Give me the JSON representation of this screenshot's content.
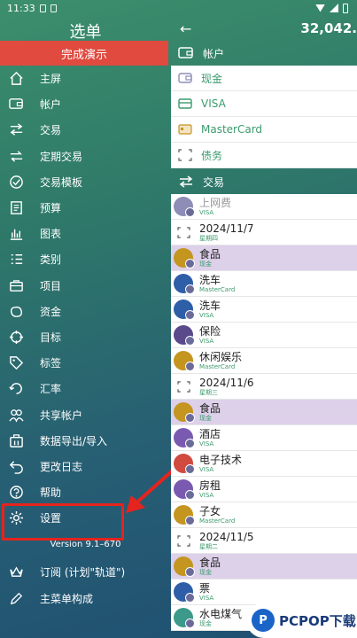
{
  "status": {
    "time": "11:33"
  },
  "drawer": {
    "title": "选单",
    "finish_demo": "完成演示",
    "items": [
      {
        "label": "主屏",
        "icon": "home-icon"
      },
      {
        "label": "帐户",
        "icon": "wallet-icon"
      },
      {
        "label": "交易",
        "icon": "swap-icon"
      },
      {
        "label": "定期交易",
        "icon": "recurring-icon"
      },
      {
        "label": "交易模板",
        "icon": "template-icon"
      },
      {
        "label": "预算",
        "icon": "budget-icon"
      },
      {
        "label": "图表",
        "icon": "chart-icon"
      },
      {
        "label": "类别",
        "icon": "category-icon"
      },
      {
        "label": "项目",
        "icon": "project-icon"
      },
      {
        "label": "资金",
        "icon": "funds-icon"
      },
      {
        "label": "目标",
        "icon": "target-icon"
      },
      {
        "label": "标签",
        "icon": "tag-icon"
      },
      {
        "label": "汇率",
        "icon": "exchange-icon"
      },
      {
        "label": "共享帐户",
        "icon": "shared-icon"
      },
      {
        "label": "数据导出/导入",
        "icon": "export-icon"
      },
      {
        "label": "更改日志",
        "icon": "changelog-icon"
      },
      {
        "label": "帮助",
        "icon": "help-icon"
      },
      {
        "label": "设置",
        "icon": "gear-icon"
      }
    ],
    "version": "Version 9.1–670",
    "items2": [
      {
        "label": "订阅 (计划\"轨道\")",
        "icon": "crown-icon"
      },
      {
        "label": "主菜单构成",
        "icon": "edit-icon"
      }
    ]
  },
  "right": {
    "total": "32,042.",
    "accounts_label": "帐户",
    "accounts": [
      {
        "name": "现金",
        "icon": "cash-icon"
      },
      {
        "name": "VISA",
        "icon": "card-icon"
      },
      {
        "name": "MasterCard",
        "icon": "card-icon"
      },
      {
        "name": "债务",
        "icon": "debt-icon"
      }
    ],
    "transactions_label": "交易",
    "transactions": [
      {
        "title": "上网费",
        "sub": "VISA",
        "kind": "faded",
        "color": "#8d8db8"
      },
      {
        "title": "2024/11/7",
        "sub": "星期四",
        "kind": "date"
      },
      {
        "title": "食品",
        "sub": "现金",
        "kind": "food",
        "color": "#c4951f"
      },
      {
        "title": "洗车",
        "sub": "MasterCard",
        "kind": "",
        "color": "#2f5ea8"
      },
      {
        "title": "洗车",
        "sub": "VISA",
        "kind": "",
        "color": "#2f5ea8"
      },
      {
        "title": "保险",
        "sub": "VISA",
        "kind": "",
        "color": "#5a4a8c"
      },
      {
        "title": "休闲娱乐",
        "sub": "MasterCard",
        "kind": "",
        "color": "#c4951f"
      },
      {
        "title": "2024/11/6",
        "sub": "星期三",
        "kind": "date"
      },
      {
        "title": "食品",
        "sub": "现金",
        "kind": "food",
        "color": "#c4951f"
      },
      {
        "title": "酒店",
        "sub": "VISA",
        "kind": "",
        "color": "#7a5ab0"
      },
      {
        "title": "电子技术",
        "sub": "VISA",
        "kind": "",
        "color": "#d04a3f"
      },
      {
        "title": "房租",
        "sub": "VISA",
        "kind": "",
        "color": "#7a5ab0"
      },
      {
        "title": "子女",
        "sub": "MasterCard",
        "kind": "",
        "color": "#c4951f"
      },
      {
        "title": "2024/11/5",
        "sub": "星期二",
        "kind": "date"
      },
      {
        "title": "食品",
        "sub": "现金",
        "kind": "food",
        "color": "#c4951f"
      },
      {
        "title": "票",
        "sub": "VISA",
        "kind": "",
        "color": "#2f5ea8"
      },
      {
        "title": "水电煤气",
        "sub": "现金",
        "kind": "",
        "color": "#3b9a8a"
      }
    ]
  },
  "watermark": {
    "text": "PCPOP下载"
  }
}
